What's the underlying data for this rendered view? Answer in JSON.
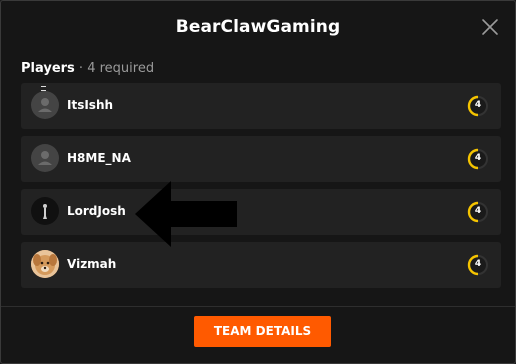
{
  "modal": {
    "title": "BearClawGaming",
    "close_icon": "close-icon"
  },
  "players_section": {
    "label": "Players",
    "separator": " · ",
    "required_text": "4 required"
  },
  "players": [
    {
      "name": "ItsIshh",
      "avatar": "default-avatar-icon",
      "level": "4"
    },
    {
      "name": "H8ME_NA",
      "avatar": "default-avatar-icon",
      "level": "4"
    },
    {
      "name": "LordJosh",
      "avatar": "custom-avatar-dark",
      "level": "4"
    },
    {
      "name": "Vizmah",
      "avatar": "custom-avatar-dog",
      "level": "4"
    }
  ],
  "footer": {
    "team_details_label": "TEAM DETAILS"
  },
  "colors": {
    "accent": "#ff5a00",
    "level_ring": "#f5c400",
    "row_bg": "#222222",
    "modal_bg": "#161616"
  }
}
